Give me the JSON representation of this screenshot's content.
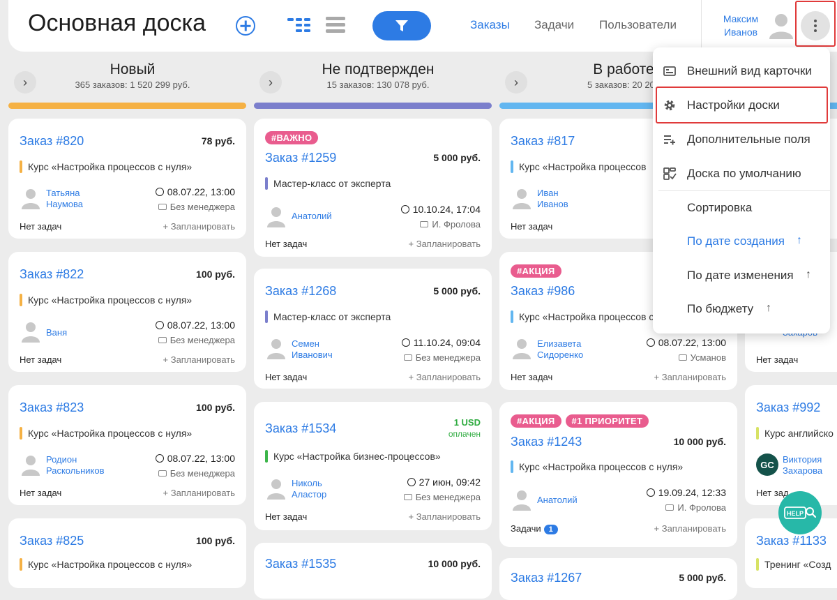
{
  "header": {
    "title": "Основная доска",
    "nav": [
      "Заказы",
      "Задачи",
      "Пользователи"
    ],
    "user_first": "Максим",
    "user_last": "Иванов"
  },
  "colors": {
    "accent": "#2d7be4",
    "col_new": "#f5b144",
    "col_unconfirmed": "#7b7fcc",
    "col_in_work": "#62b6f0",
    "tag": "#e95c8e",
    "highlight": "#e03a3a",
    "help": "#27b8a8"
  },
  "columns": [
    {
      "title": "Новый",
      "stats": "365 заказов: 1 520 299 руб."
    },
    {
      "title": "Не подтвержден",
      "stats": "15 заказов: 130 078 руб."
    },
    {
      "title": "В работе",
      "stats": "5 заказов: 20 200"
    }
  ],
  "cards": {
    "c820": {
      "title": "Заказ #820",
      "price": "78 руб.",
      "product": "Курс «Настройка процессов с нуля»",
      "person1": "Татьяна",
      "person2": "Наумова",
      "date": "08.07.22, 13:00",
      "manager": "Без менеджера",
      "tasks": "Нет задач",
      "plan": "+ Запланировать"
    },
    "c822": {
      "title": "Заказ #822",
      "price": "100 руб.",
      "product": "Курс «Настройка процессов с нуля»",
      "person1": "Ваня",
      "date": "08.07.22, 13:00",
      "manager": "Без менеджера",
      "tasks": "Нет задач",
      "plan": "+ Запланировать"
    },
    "c823": {
      "title": "Заказ #823",
      "price": "100 руб.",
      "product": "Курс «Настройка процессов с нуля»",
      "person1": "Родион",
      "person2": "Раскольников",
      "date": "08.07.22, 13:00",
      "manager": "Без менеджера",
      "tasks": "Нет задач",
      "plan": "+ Запланировать"
    },
    "c825": {
      "title": "Заказ #825",
      "price": "100 руб.",
      "product": "Курс «Настройка процессов с нуля»"
    },
    "c1259": {
      "tag": "#ВАЖНО",
      "title": "Заказ #1259",
      "price": "5 000 руб.",
      "product": "Мастер-класс от эксперта",
      "person1": "Анатолий",
      "date": "10.10.24, 17:04",
      "manager": "И. Фролова",
      "tasks": "Нет задач",
      "plan": "+ Запланировать"
    },
    "c1268": {
      "title": "Заказ #1268",
      "price": "5 000 руб.",
      "product": "Мастер-класс от эксперта",
      "person1": "Семен",
      "person2": "Иванович",
      "date": "11.10.24, 09:04",
      "manager": "Без менеджера",
      "tasks": "Нет задач",
      "plan": "+ Запланировать"
    },
    "c1534": {
      "title": "Заказ #1534",
      "usd": "1 USD",
      "paid": "оплачен",
      "product": "Курс «Настройка бизнес-процессов»",
      "person1": "Николь",
      "person2": "Аластор",
      "date": "27 июн, 09:42",
      "manager": "Без менеджера",
      "tasks": "Нет задач",
      "plan": "+ Запланировать"
    },
    "c1535": {
      "title": "Заказ #1535",
      "price": "10 000 руб."
    },
    "c817": {
      "title": "Заказ #817",
      "product": "Курс «Настройка процессов",
      "person1": "Иван",
      "person2": "Иванов",
      "tasks": "Нет задач"
    },
    "c986": {
      "tag": "#АКЦИЯ",
      "title": "Заказ #986",
      "product": "Курс «Настройка процессов с нуля»",
      "person1": "Елизавета",
      "person2": "Сидоренко",
      "date": "08.07.22, 13:00",
      "manager": "Усманов",
      "tasks": "Нет задач",
      "plan": "+ Запланировать"
    },
    "c1243": {
      "tag1": "#АКЦИЯ",
      "tag2": "#1 ПРИОРИТЕТ",
      "title": "Заказ #1243",
      "price": "10 000 руб.",
      "product": "Курс «Настройка процессов с нуля»",
      "person1": "Анатолий",
      "date": "19.09.24, 12:33",
      "manager": "И. Фролова",
      "tasks": "Задачи",
      "tasks_count": "1",
      "plan": "+ Запланировать"
    },
    "c1267": {
      "title": "Заказ #1267",
      "price": "5 000 руб."
    },
    "c992": {
      "title": "Заказ #992",
      "product": "Курс английско",
      "person1": "Виктория",
      "person2": "Захарова",
      "avatar_initials": "GC",
      "tasks": "Нет зад"
    },
    "c1133": {
      "title": "Заказ #1133",
      "product": "Тренинг «Созд"
    },
    "c4": {
      "person1": "Захаров",
      "tasks": "Нет задач"
    }
  },
  "menu": {
    "items": [
      "Внешний вид карточки",
      "Настройки доски",
      "Дополнительные поля",
      "Доска по умолчанию"
    ],
    "sort_label": "Сортировка",
    "sort_options": [
      "По дате создания",
      "По дате изменения",
      "По бюджету"
    ],
    "sort_active": "По дате создания"
  },
  "help_label": "HELP"
}
